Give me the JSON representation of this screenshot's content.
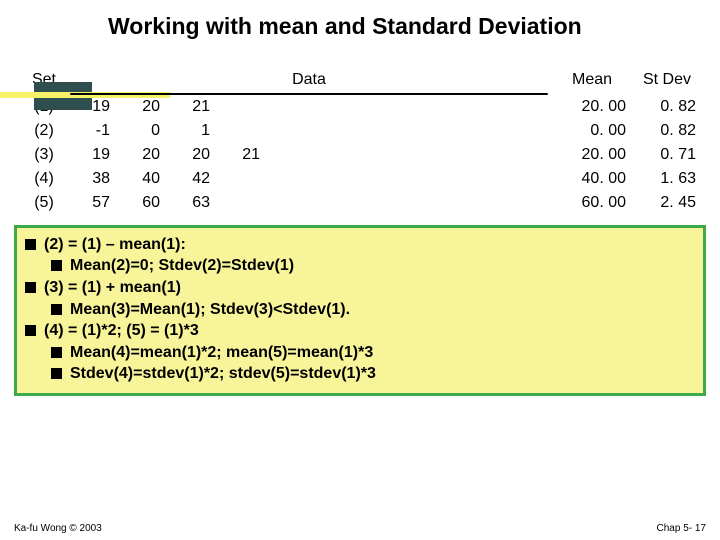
{
  "title": "Working with mean and Standard Deviation",
  "headers": {
    "set": "Set",
    "data": "Data",
    "mean": "Mean",
    "stdev": "St Dev"
  },
  "rows": [
    {
      "set": "(1)",
      "d": [
        "19",
        "20",
        "21",
        ""
      ],
      "mean": "20. 00",
      "sd": "0. 82"
    },
    {
      "set": "(2)",
      "d": [
        "-1",
        "0",
        "1",
        ""
      ],
      "mean": "0. 00",
      "sd": "0. 82"
    },
    {
      "set": "(3)",
      "d": [
        "19",
        "20",
        "20",
        "21"
      ],
      "mean": "20. 00",
      "sd": "0. 71"
    },
    {
      "set": "(4)",
      "d": [
        "38",
        "40",
        "42",
        ""
      ],
      "mean": "40. 00",
      "sd": "1. 63"
    },
    {
      "set": "(5)",
      "d": [
        "57",
        "60",
        "63",
        ""
      ],
      "mean": "60. 00",
      "sd": "2. 45"
    }
  ],
  "notes": {
    "l1a": "(2) = (1) – mean(1):",
    "l2a": "Mean(2)=0; Stdev(2)=Stdev(1)",
    "l1b": "(3) = (1) + mean(1)",
    "l2b": "Mean(3)=Mean(1); Stdev(3)<Stdev(1).",
    "l1c": "(4) = (1)*2; (5) = (1)*3",
    "l2c": "Mean(4)=mean(1)*2; mean(5)=mean(1)*3",
    "l2d": "Stdev(4)=stdev(1)*2; stdev(5)=stdev(1)*3"
  },
  "footer": {
    "left": "Ka-fu Wong © 2003",
    "right": "Chap 5- 17"
  }
}
